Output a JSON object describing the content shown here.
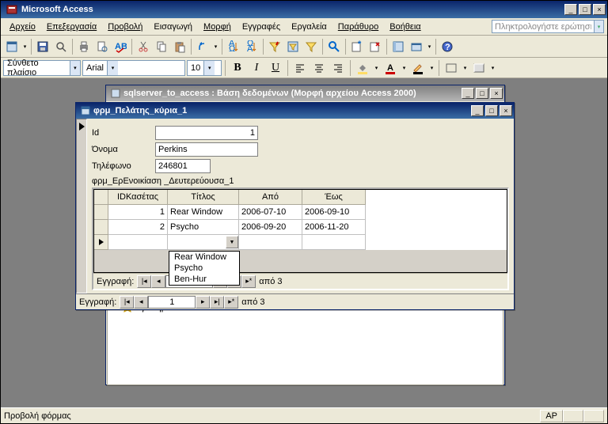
{
  "app": {
    "title": "Microsoft Access"
  },
  "menu": {
    "items": [
      {
        "text": "Αρχείο",
        "u": 0
      },
      {
        "text": "Επεξεργασία",
        "u": 0
      },
      {
        "text": "Προβολή",
        "u": 0
      },
      {
        "text": "Εισαγωγή",
        "u": 5
      },
      {
        "text": "Μορφή",
        "u": 0
      },
      {
        "text": "Εγγραφές",
        "u": 6
      },
      {
        "text": "Εργαλεία",
        "u": 1
      },
      {
        "text": "Παράθυρο",
        "u": 0
      },
      {
        "text": "Βοήθεια",
        "u": 0
      }
    ],
    "ask_placeholder": "Πληκτρολογήστε ερώτηση"
  },
  "fmt": {
    "style_label": "Σύνθετο πλαίσιο",
    "font": "Arial",
    "size": "10",
    "bold": "B",
    "italic": "I",
    "underline": "U"
  },
  "dbwin": {
    "title": "sqlserver_to_access : Βάση δεδομένων (Μορφή αρχείου Access 2000)"
  },
  "formwin": {
    "title": "φρμ_Πελάτης_κύρια_1"
  },
  "form": {
    "labels": {
      "id": "Id",
      "name": "Όνομα",
      "phone": "Τηλέφωνο"
    },
    "values": {
      "id": "1",
      "name": "Perkins",
      "phone": "246801"
    },
    "subform_label": "φρμ_ΕρΕνοικίαση _Δευτερεύουσα_1"
  },
  "grid": {
    "headers": [
      "IDΚασέτας",
      "Τίτλος",
      "Από",
      "Έως"
    ],
    "rows": [
      {
        "id": "1",
        "title": "Rear Window",
        "from": "2006-07-10",
        "to": "2006-09-10"
      },
      {
        "id": "2",
        "title": "Psycho",
        "from": "2006-09-20",
        "to": "2006-11-20"
      }
    ]
  },
  "dropdown": {
    "options": [
      "Rear Window",
      "Psycho",
      "Ben-Hur"
    ]
  },
  "nav": {
    "label": "Εγγραφή:",
    "of": "από",
    "sub_current": "",
    "sub_total": "3",
    "main_current": "1",
    "main_total": "3"
  },
  "fav": {
    "label": "Αγαπημ..."
  },
  "status": {
    "text": "Προβολή φόρμας",
    "indicator": "ΑΡ"
  }
}
